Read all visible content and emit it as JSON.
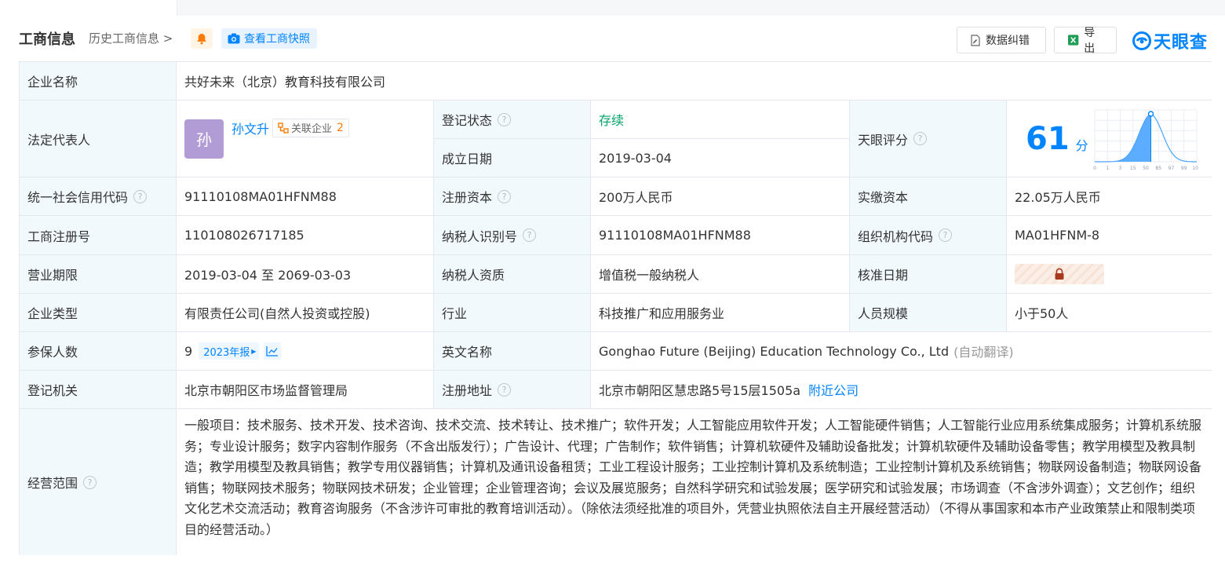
{
  "header": {
    "title": "工商信息",
    "history_link": "历史工商信息",
    "snapshot_label": "查看工商快照",
    "correction_label": "数据纠错",
    "export_label": "导出",
    "brand": "天眼查"
  },
  "rows": {
    "company_name": {
      "label": "企业名称",
      "value": "共好未来（北京）教育科技有限公司"
    },
    "legal_rep": {
      "label": "法定代表人",
      "avatar": "孙",
      "name": "孙文升",
      "related_label": "关联企业",
      "related_count": "2"
    },
    "reg_status": {
      "label": "登记状态",
      "value": "存续"
    },
    "found_date": {
      "label": "成立日期",
      "value": "2019-03-04"
    },
    "tianyan_score": {
      "label": "天眼评分",
      "value": "61",
      "unit": "分",
      "axis": [
        "0",
        "1",
        "3",
        "15",
        "50",
        "85",
        "97",
        "99",
        "100"
      ],
      "percentile": 0.55
    },
    "credit_code": {
      "label": "统一社会信用代码",
      "value": "91110108MA01HFNM88"
    },
    "reg_capital": {
      "label": "注册资本",
      "value": "200万人民币"
    },
    "paid_capital": {
      "label": "实缴资本",
      "value": "22.05万人民币"
    },
    "reg_no": {
      "label": "工商注册号",
      "value": "110108026717185"
    },
    "taxpayer_id": {
      "label": "纳税人识别号",
      "value": "91110108MA01HFNM88"
    },
    "org_code": {
      "label": "组织机构代码",
      "value": "MA01HFNM-8"
    },
    "term": {
      "label": "营业期限",
      "value": "2019-03-04 至 2069-03-03"
    },
    "tax_qual": {
      "label": "纳税人资质",
      "value": "增值税一般纳税人"
    },
    "approve_date": {
      "label": "核准日期"
    },
    "company_type": {
      "label": "企业类型",
      "value": "有限责任公司(自然人投资或控股)"
    },
    "industry": {
      "label": "行业",
      "value": "科技推广和应用服务业"
    },
    "staff_size": {
      "label": "人员规模",
      "value": "小于50人"
    },
    "insured": {
      "label": "参保人数",
      "value": "9",
      "year_badge": "2023年报"
    },
    "english_name": {
      "label": "英文名称",
      "value": "Gonghao Future (Beijing) Education Technology Co., Ltd",
      "note": "(自动翻译)"
    },
    "reg_authority": {
      "label": "登记机关",
      "value": "北京市朝阳区市场监督管理局"
    },
    "reg_address": {
      "label": "注册地址",
      "value": "北京市朝阳区慧忠路5号15层1505a",
      "nearby": "附近公司"
    },
    "scope": {
      "label": "经营范围",
      "value": "一般项目：技术服务、技术开发、技术咨询、技术交流、技术转让、技术推广；软件开发；人工智能应用软件开发；人工智能硬件销售；人工智能行业应用系统集成服务；计算机系统服务；专业设计服务；数字内容制作服务（不含出版发行）；广告设计、代理；广告制作；软件销售；计算机软硬件及辅助设备批发；计算机软硬件及辅助设备零售；教学用模型及教具制造；教学用模型及教具销售；教学专用仪器销售；计算机及通讯设备租赁；工业工程设计服务；工业控制计算机及系统制造；工业控制计算机及系统销售；物联网设备制造；物联网设备销售；物联网技术服务；物联网技术研发；企业管理；企业管理咨询；会议及展览服务；自然科学研究和试验发展；医学研究和试验发展；市场调查（不含涉外调查）；文艺创作；组织文化艺术交流活动；教育咨询服务（不含涉许可审批的教育培训活动）。（除依法须经批准的项目外，凭营业执照依法自主开展经营活动）（不得从事国家和本市产业政策禁止和限制类项目的经营活动。）"
    }
  },
  "colors": {
    "accent": "#0084ff",
    "status_green": "#00a367",
    "label_bg": "#f2f9fc",
    "orange": "#ff7a00"
  }
}
